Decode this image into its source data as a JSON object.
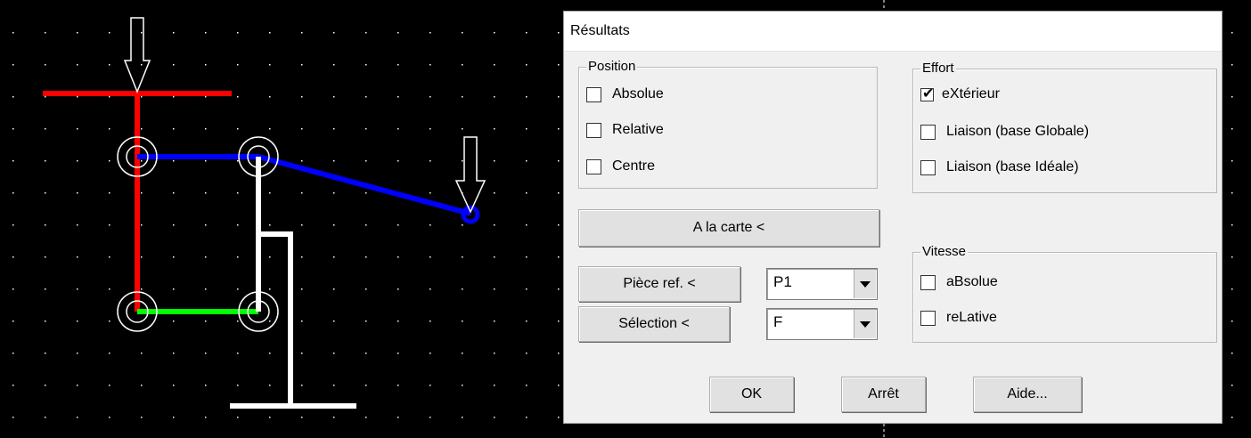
{
  "colors": {
    "background": "#000000",
    "grid_dot": "#ffffff",
    "red_member": "#ff0000",
    "blue_member": "#0000ff",
    "green_member": "#00ff00",
    "white_member": "#ffffff"
  },
  "dialog": {
    "title": "Résultats",
    "position_group": {
      "legend": "Position",
      "items": [
        {
          "label": "Absolue",
          "checked": false
        },
        {
          "label": "Relative",
          "checked": false
        },
        {
          "label": "Centre",
          "checked": false
        }
      ]
    },
    "effort_group": {
      "legend": "Effort",
      "items": [
        {
          "label": "eXtérieur",
          "checked": true
        },
        {
          "label": "Liaison (base Globale)",
          "checked": false
        },
        {
          "label": "Liaison (base Idéale)",
          "checked": false
        }
      ]
    },
    "vitesse_group": {
      "legend": "Vitesse",
      "items": [
        {
          "label": "aBsolue",
          "checked": false
        },
        {
          "label": "reLative",
          "checked": false
        }
      ]
    },
    "a_la_carte_label": "A la carte <",
    "piece_ref_label": "Pièce ref. <",
    "piece_ref_value": "P1",
    "selection_label": "Sélection <",
    "selection_value": "F",
    "ok_label": "OK",
    "arret_label": "Arrêt",
    "aide_label": "Aide..."
  }
}
